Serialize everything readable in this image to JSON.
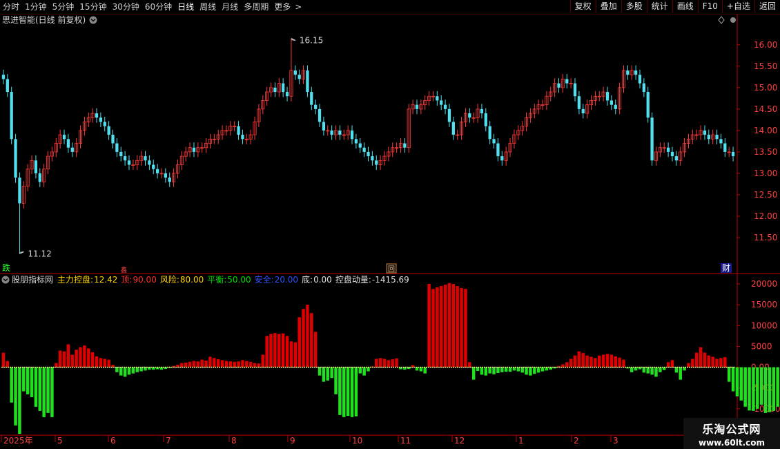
{
  "toolbar": {
    "periods": [
      "分时",
      "1分钟",
      "5分钟",
      "15分钟",
      "30分钟",
      "60分钟",
      "日线",
      "周线",
      "月线",
      "多周期",
      "更多"
    ],
    "active_period": "日线",
    "more_icon": "chevron-right-icon",
    "buttons": [
      "复权",
      "叠加",
      "多股",
      "统计",
      "画线",
      "F10",
      "+自选",
      "返回"
    ]
  },
  "main_chart": {
    "title": "思进智能(日线 前复权)",
    "title_icon": "chevron-down-icon",
    "corner_icon": "diamond-icon",
    "y_ticks": [
      "16.00",
      "15.50",
      "15.00",
      "14.50",
      "14.00",
      "13.50",
      "13.00",
      "12.50",
      "12.00",
      "11.50"
    ],
    "high_label": "16.15",
    "low_label": "11.12",
    "markers": {
      "left": "跌",
      "right": "财",
      "center_box": "回",
      "small": "鑫"
    },
    "colors": {
      "up": "#ff3a3a",
      "down": "#50e0f0",
      "axis": "#c00000",
      "text": "#ff4040"
    }
  },
  "indicator": {
    "name": "股朋指标网",
    "values": [
      {
        "label": "主力控盘:",
        "value": "12.42",
        "color": "#ffd700"
      },
      {
        "label": "顶:",
        "value": "90.00",
        "color": "#ff3030"
      },
      {
        "label": "风险:",
        "value": "80.00",
        "color": "#ffd700"
      },
      {
        "label": "平衡:",
        "value": "50.00",
        "color": "#00e000"
      },
      {
        "label": "安全:",
        "value": "20.00",
        "color": "#3050ff"
      },
      {
        "label": "底:",
        "value": "0.00",
        "color": "#e0e0e0"
      },
      {
        "label": "控盘动量:",
        "value": "-1415.69",
        "color": "#e0e0e0"
      }
    ],
    "y_ticks": [
      "20000",
      "15000",
      "10000",
      "5000",
      "0.00",
      "-5000",
      "-10000"
    ],
    "colors": {
      "positive": "#e00000",
      "negative": "#20e020",
      "baseline": "#ffff90"
    }
  },
  "time_axis": [
    "2025年",
    "5",
    "6",
    "7",
    "8",
    "9",
    "10",
    "11",
    "12",
    "1",
    "2",
    "3"
  ],
  "watermark": {
    "name": "乐淘公式网",
    "url": "www.60lt.com"
  },
  "chart_data": [
    {
      "type": "candlestick",
      "title": "思进智能(日线 前复权)",
      "ylim": [
        11.0,
        16.4
      ],
      "annotations": {
        "high": 16.15,
        "low": 11.12
      },
      "close": [
        15.2,
        14.9,
        13.8,
        12.9,
        12.3,
        12.7,
        13.1,
        13.3,
        13.0,
        12.8,
        13.1,
        13.4,
        13.5,
        13.7,
        13.9,
        13.8,
        13.6,
        13.5,
        13.7,
        14.0,
        14.2,
        14.3,
        14.4,
        14.3,
        14.2,
        14.1,
        13.9,
        13.7,
        13.5,
        13.4,
        13.3,
        13.2,
        13.2,
        13.3,
        13.4,
        13.3,
        13.2,
        13.1,
        13.0,
        13.0,
        12.9,
        12.8,
        13.0,
        13.2,
        13.4,
        13.5,
        13.6,
        13.5,
        13.6,
        13.6,
        13.7,
        13.8,
        13.8,
        13.9,
        14.0,
        14.0,
        14.1,
        14.1,
        13.9,
        13.8,
        13.8,
        13.9,
        14.2,
        14.5,
        14.7,
        14.9,
        15.0,
        14.9,
        15.1,
        14.9,
        14.8,
        15.4,
        15.3,
        15.2,
        15.4,
        14.9,
        14.6,
        14.5,
        14.2,
        14.0,
        14.0,
        13.9,
        14.0,
        13.9,
        13.9,
        14.0,
        13.8,
        13.7,
        13.6,
        13.5,
        13.4,
        13.3,
        13.2,
        13.3,
        13.4,
        13.5,
        13.6,
        13.6,
        13.7,
        13.6,
        14.5,
        14.6,
        14.5,
        14.6,
        14.7,
        14.8,
        14.8,
        14.7,
        14.6,
        14.5,
        14.2,
        13.9,
        13.9,
        14.2,
        14.4,
        14.3,
        14.3,
        14.5,
        14.4,
        14.1,
        13.8,
        13.7,
        13.4,
        13.3,
        13.5,
        13.7,
        13.9,
        14.0,
        14.1,
        14.3,
        14.4,
        14.5,
        14.6,
        14.6,
        14.8,
        14.9,
        15.1,
        15.0,
        15.2,
        15.1,
        15.1,
        14.8,
        14.5,
        14.4,
        14.6,
        14.7,
        14.8,
        14.8,
        14.9,
        14.7,
        14.6,
        14.5,
        15.0,
        15.4,
        15.3,
        15.4,
        15.3,
        15.1,
        14.9,
        14.3,
        13.3,
        13.5,
        13.6,
        13.6,
        13.5,
        13.4,
        13.3,
        13.5,
        13.7,
        13.8,
        13.9,
        13.9,
        14.0,
        13.9,
        13.8,
        13.9,
        13.8,
        13.7,
        13.5,
        13.5,
        13.4
      ],
      "y_ticks": [
        16.0,
        15.5,
        15.0,
        14.5,
        14.0,
        13.5,
        13.0,
        12.5,
        12.0,
        11.5
      ]
    },
    {
      "type": "bar",
      "title": "股朋指标网",
      "ylim": [
        -16000,
        21000
      ],
      "series": [
        {
          "name": "控盘动量",
          "values": [
            3500,
            1500,
            -8500,
            -14000,
            -16000,
            -5800,
            -6500,
            -7200,
            -9500,
            -10500,
            -12000,
            -11000,
            -12000,
            1000,
            4000,
            3800,
            5500,
            3000,
            4200,
            4800,
            5200,
            4500,
            3600,
            2600,
            2200,
            2000,
            1800,
            600,
            -1200,
            -2000,
            -2300,
            -1800,
            -1500,
            -1200,
            -1000,
            -800,
            -600,
            -600,
            -500,
            -600,
            -400,
            -200,
            300,
            600,
            1000,
            1100,
            1300,
            1500,
            1400,
            1800,
            1600,
            2500,
            2200,
            1900,
            1700,
            1500,
            1400,
            1300,
            1400,
            1700,
            1500,
            1300,
            1000,
            900,
            3000,
            7500,
            8000,
            8200,
            8000,
            8100,
            7500,
            6200,
            6000,
            12000,
            14000,
            15000,
            13000,
            8500,
            -2000,
            -3500,
            -3200,
            -2600,
            -6500,
            -11500,
            -12000,
            -11700,
            -12000,
            -11800,
            -1500,
            -2000,
            -1000,
            200,
            2000,
            2200,
            2000,
            1700,
            1900,
            2100,
            -500,
            -600,
            -400,
            500,
            -800,
            -1000,
            -1500,
            20000,
            18800,
            19200,
            19500,
            19800,
            20200,
            20000,
            19500,
            19000,
            18800,
            1200,
            -3000,
            -900,
            -1800,
            -2000,
            -1500,
            -1700,
            -1400,
            -1200,
            -1100,
            -1100,
            -800,
            -1000,
            -1300,
            -1800,
            -2000,
            -1600,
            -1300,
            -1000,
            -800,
            -600,
            -300,
            300,
            700,
            1200,
            2000,
            2800,
            3800,
            3400,
            2800,
            2500,
            2200,
            2800,
            3000,
            3200,
            3000,
            2600,
            2300,
            1800,
            -300,
            -1200,
            -800,
            -500,
            -1300,
            -1500,
            -1800,
            -2300,
            -1200,
            -700,
            1200,
            1700,
            -1300,
            -3000,
            -800,
            1000,
            2000,
            3500,
            4800,
            3500,
            2800,
            2500,
            2000,
            2200,
            2400,
            -3500,
            -5800,
            -7000,
            -8000,
            -9500,
            -10400,
            -10500,
            -10000,
            -9000,
            -11000,
            -10800,
            -10500,
            -9500,
            -200,
            -400,
            200,
            -500,
            600,
            800,
            700,
            1000,
            -2500,
            -1500
          ]
        }
      ],
      "y_ticks": [
        20000,
        15000,
        10000,
        5000,
        0,
        -5000,
        -10000
      ],
      "reference_lines": {
        "baseline": 0
      }
    }
  ]
}
